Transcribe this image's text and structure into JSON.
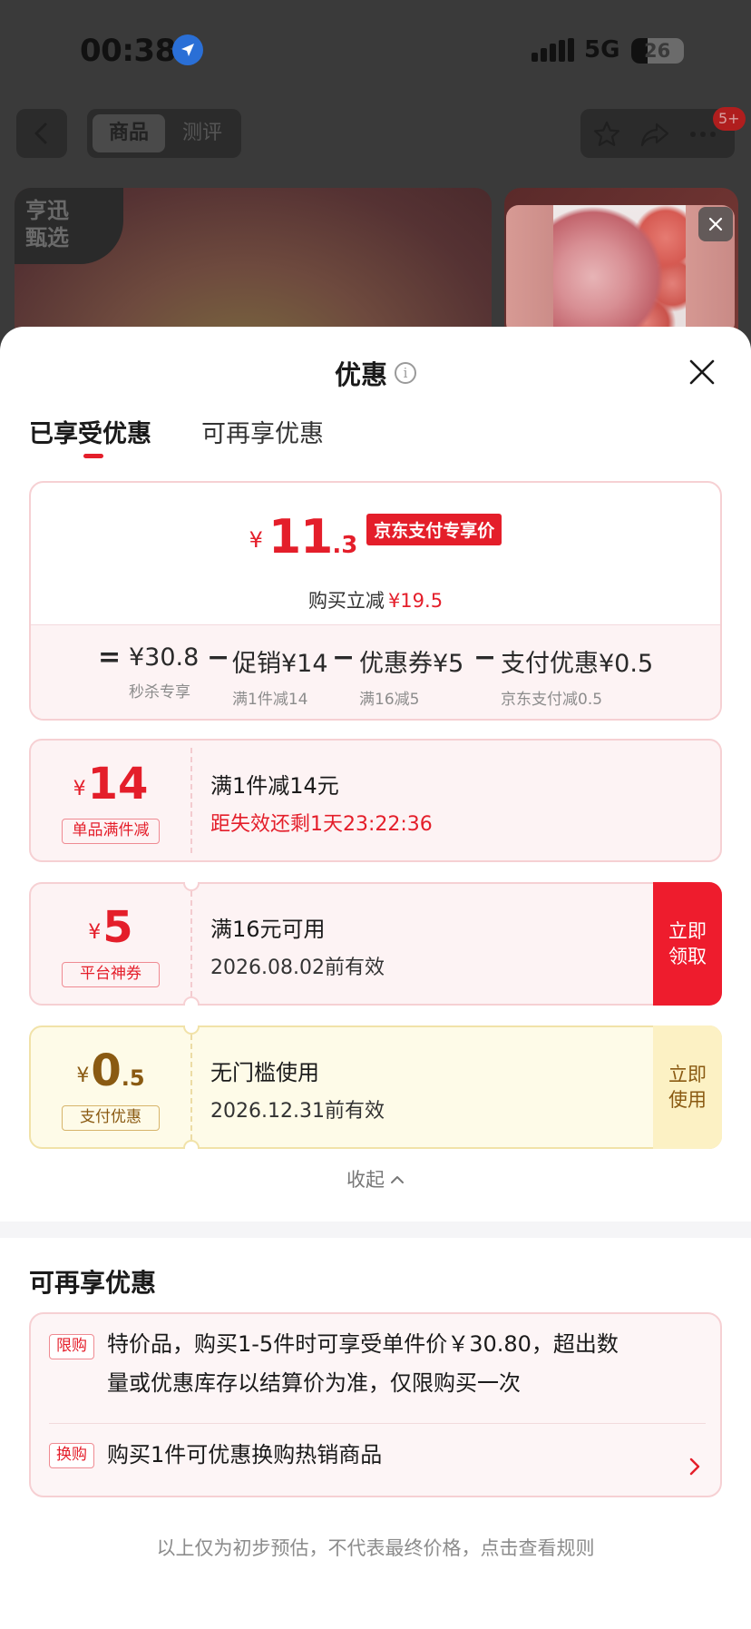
{
  "status_bar": {
    "time": "00:38",
    "network": "5G",
    "battery": "26"
  },
  "nav": {
    "tabs": [
      {
        "label": "商品",
        "active": true
      },
      {
        "label": "测评",
        "active": false
      }
    ],
    "notification_badge": "5+"
  },
  "hero": {
    "store_tag": "亨迅甄选"
  },
  "sheet": {
    "title": "优惠",
    "tabs": [
      {
        "label": "已享受优惠",
        "active": true
      },
      {
        "label": "可再享优惠",
        "active": false
      }
    ],
    "summary": {
      "currency": "¥",
      "price_int": "11",
      "price_dec": ".3",
      "price_tag": "京东支付专享价",
      "reduce_label": "购买立减",
      "reduce_value": "¥19.5",
      "formula": [
        {
          "main": "¥30.8",
          "sub": "秒杀专享"
        },
        {
          "main": "促销¥14",
          "sub": "满1件减14"
        },
        {
          "main": "优惠券¥5",
          "sub": "满16减5"
        },
        {
          "main": "支付优惠¥0.5",
          "sub": "京东支付减0.5"
        }
      ],
      "equals": "=",
      "minus": "−"
    },
    "coupons": [
      {
        "currency": "¥",
        "value": "14",
        "decimal": "",
        "label": "单品满件减",
        "title": "满1件减14元",
        "subtitle": "距失效还剩1天23:22:36",
        "action": ""
      },
      {
        "currency": "¥",
        "value": "5",
        "decimal": "",
        "label": "平台神券",
        "title": "满16元可用",
        "subtitle": "2026.08.02前有效",
        "action": "立即领取"
      },
      {
        "currency": "¥",
        "value": "0",
        "decimal": ".5",
        "label": "支付优惠",
        "title": "无门槛使用",
        "subtitle": "2026.12.31前有效",
        "action": "立即使用"
      }
    ],
    "collapse_label": "收起",
    "more": {
      "title": "可再享优惠",
      "items": [
        {
          "tag": "限购",
          "text_line1": "特价品，购买1-5件时可享受单件价￥30.80，超出数",
          "text_line2": "量或优惠库存以结算价为准，仅限购买一次"
        },
        {
          "tag": "换购",
          "text": "购买1件可优惠换购热销商品"
        }
      ]
    },
    "footer_note": "以上仅为初步预估，不代表最终价格，点击查看规则"
  },
  "colors": {
    "accent": "#e41e2a",
    "gold": "#8a5a12",
    "card_bg": "#fdf3f4"
  }
}
